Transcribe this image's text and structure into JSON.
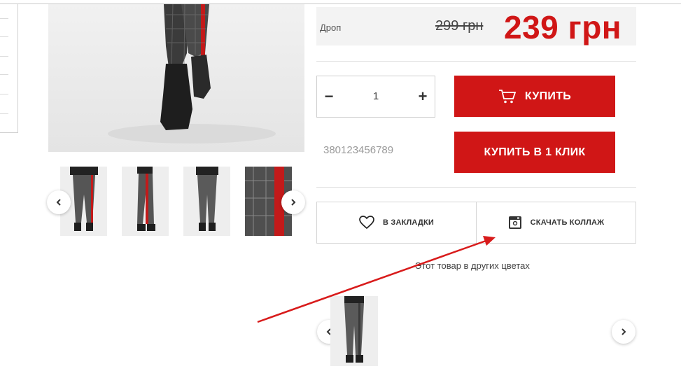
{
  "gallery": {
    "prev_label": "‹",
    "next_label": "›",
    "thumbnail_count": 4
  },
  "price": {
    "drop_label": "Дроп",
    "old_price": "299 грн",
    "new_price": "239 грн",
    "accent_color": "#d01616"
  },
  "quantity": {
    "minus": "−",
    "value": "1",
    "plus": "+"
  },
  "buttons": {
    "buy": "КУПИТЬ",
    "buy_one_click": "КУПИТЬ В 1 КЛИК"
  },
  "phone_input": {
    "placeholder": "380123456789"
  },
  "actions": {
    "bookmarks": "В ЗАКЛАДКИ",
    "download_collage": "СКАЧАТЬ КОЛЛАЖ"
  },
  "other_colors": {
    "title": "Этот товар в других цветах"
  },
  "icons": {
    "cart": "cart-icon",
    "heart": "heart-icon",
    "instagram": "instagram-icon",
    "prev": "chevron-left-icon",
    "next": "chevron-right-icon"
  }
}
